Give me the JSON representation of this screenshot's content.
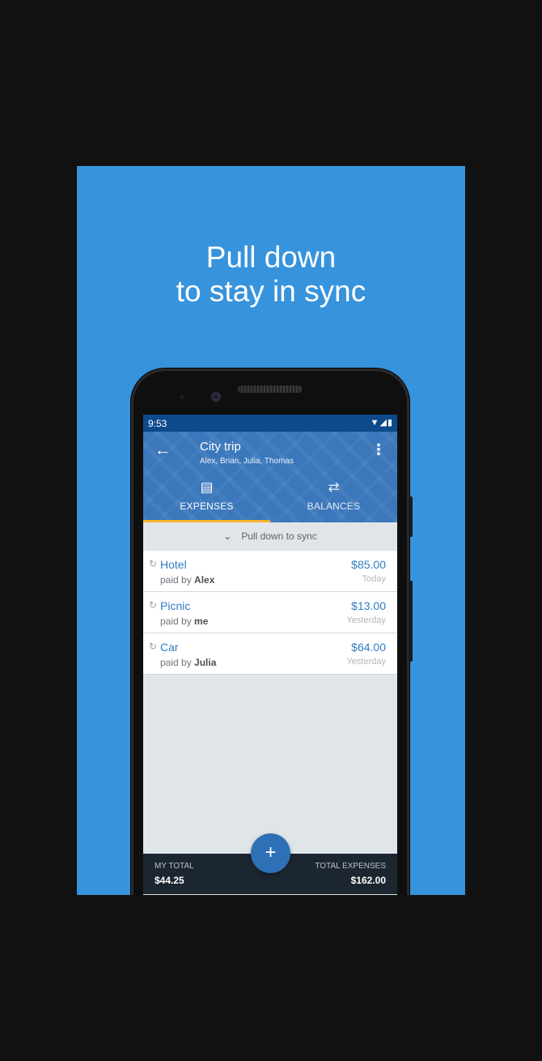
{
  "headline": {
    "line1": "Pull down",
    "line2": "to stay in sync"
  },
  "colors": {
    "panel": "#3793dc",
    "app_bar": "#3a77bb",
    "status_bar": "#0d4a8c",
    "accent_indicator": "#f5b32a",
    "link_blue": "#2f7bc2",
    "footer": "#1c2631",
    "fab": "#2d70b5"
  },
  "status_bar": {
    "time": "9:53",
    "icons": [
      "wifi-icon",
      "signal-icon",
      "battery-icon"
    ]
  },
  "app_bar": {
    "title": "City trip",
    "subtitle": "Alex, Brian, Julia, Thomas",
    "back_icon": "arrow-left-icon",
    "menu_icon": "more-vert-icon"
  },
  "tabs": [
    {
      "label": "EXPENSES",
      "icon": "receipt-icon",
      "selected": true
    },
    {
      "label": "BALANCES",
      "icon": "transfer-arrows-icon",
      "selected": false
    }
  ],
  "sync_hint": "Pull down to sync",
  "expenses": [
    {
      "name": "Hotel",
      "paid_prefix": "paid by",
      "payer": "Alex",
      "amount": "$85.00",
      "date": "Today"
    },
    {
      "name": "Picnic",
      "paid_prefix": "paid by",
      "payer": "me",
      "amount": "$13.00",
      "date": "Yesterday"
    },
    {
      "name": "Car",
      "paid_prefix": "paid by",
      "payer": "Julia",
      "amount": "$64.00",
      "date": "Yesterday"
    }
  ],
  "footer": {
    "my_total_label": "MY TOTAL",
    "my_total_value": "$44.25",
    "total_label": "TOTAL EXPENSES",
    "total_value": "$162.00"
  },
  "fab": {
    "symbol": "+",
    "icon": "add-icon"
  }
}
